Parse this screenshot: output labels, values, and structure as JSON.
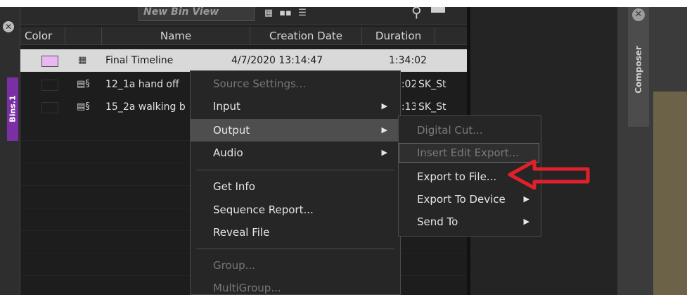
{
  "bin": {
    "view_name": "New Bin View",
    "columns": [
      "Color",
      "",
      "Name",
      "Creation Date",
      "Duration"
    ],
    "rows": [
      {
        "name": "Final Timeline",
        "date": "4/7/2020 13:14:47",
        "duration": "1:34:02",
        "extra": "",
        "color": "#e9b7f2"
      },
      {
        "name": "12_1a hand off",
        "date": "",
        "duration": "34:02",
        "extra": "SK_St",
        "color": "#1d1d1d"
      },
      {
        "name": "15_2a walking b",
        "date": "",
        "duration": "49:13",
        "extra": "SK_St",
        "color": "#1d1d1d"
      }
    ]
  },
  "left_tab": {
    "label": "Bins.1"
  },
  "context_menu": {
    "items": [
      {
        "label": "Source Settings...",
        "disabled": true
      },
      {
        "label": "Input",
        "submenu": true
      },
      {
        "label": "Output",
        "submenu": true,
        "active": true
      },
      {
        "label": "Audio",
        "submenu": true
      },
      {
        "label": "Get Info"
      },
      {
        "label": "Sequence Report..."
      },
      {
        "label": "Reveal File"
      },
      {
        "label": "Group...",
        "disabled": true
      },
      {
        "label": "MultiGroup...",
        "disabled": true
      }
    ]
  },
  "output_submenu": {
    "items": [
      {
        "label": "Digital Cut...",
        "disabled": true
      },
      {
        "label": "Insert Edit Export...",
        "disabled": true
      },
      {
        "label": "Export to File..."
      },
      {
        "label": "Export To Device",
        "submenu": true
      },
      {
        "label": "Send To",
        "submenu": true
      }
    ]
  },
  "composer": {
    "label": "Composer"
  },
  "colors": {
    "annotation_arrow": "#e0202a",
    "selected_row": "#d9d9d9",
    "purple_tab": "#7a2fa5"
  }
}
